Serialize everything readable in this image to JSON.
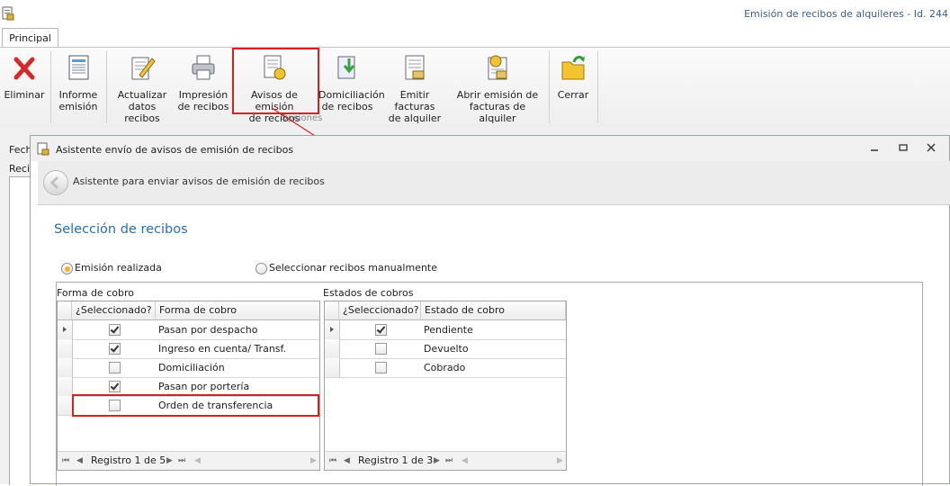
{
  "window": {
    "title": "Emisión de recibos de alquileres - Id. 244"
  },
  "tabs": [
    {
      "label": "Principal"
    }
  ],
  "ribbon": {
    "group_label": "Opciones",
    "buttons": [
      {
        "label": "Eliminar",
        "icon": "delete-x-icon"
      },
      {
        "label": "Informe\nemisión",
        "icon": "report-icon"
      },
      {
        "label": "Actualizar\ndatos recibos",
        "icon": "edit-document-icon"
      },
      {
        "label": "Impresión\nde recibos",
        "icon": "printer-icon"
      },
      {
        "label": "Avisos de emisión\nde recibos",
        "icon": "notice-icon"
      },
      {
        "label": "Domiciliación\nde recibos",
        "icon": "download-document-icon"
      },
      {
        "label": "Emitir facturas\nde alquiler",
        "icon": "invoice-icon"
      },
      {
        "label": "Abrir emisión de\nfacturas de alquiler",
        "icon": "open-invoice-icon"
      },
      {
        "label": "Cerrar",
        "icon": "close-folder-icon"
      }
    ]
  },
  "background": {
    "label1": "Fech",
    "label2": "Reci"
  },
  "dialog": {
    "title": "Asistente envío de avisos de emisión de recibos",
    "wizard_title": "Asistente para enviar avisos de emisión de recibos",
    "section_title": "Selección de recibos",
    "options": [
      {
        "label": "Emisión realizada",
        "selected": true
      },
      {
        "label": "Seleccionar recibos manualmente",
        "selected": false
      }
    ],
    "forma_cobro": {
      "label": "Forma de cobro",
      "columns": [
        "¿Seleccionado?",
        "Forma de cobro"
      ],
      "rows": [
        {
          "checked": true,
          "value": "Pasan por despacho"
        },
        {
          "checked": true,
          "value": "Ingreso en cuenta/ Transf."
        },
        {
          "checked": false,
          "value": "Domiciliación"
        },
        {
          "checked": true,
          "value": "Pasan por portería"
        },
        {
          "checked": false,
          "value": "Orden de transferencia"
        }
      ],
      "nav_text": "Registro 1 de 5"
    },
    "estados_cobro": {
      "label": "Estados de cobros",
      "columns": [
        "¿Seleccionado?",
        "Estado de cobro"
      ],
      "rows": [
        {
          "checked": true,
          "value": "Pendiente"
        },
        {
          "checked": false,
          "value": "Devuelto"
        },
        {
          "checked": false,
          "value": "Cobrado"
        }
      ],
      "nav_text": "Registro 1 de 3"
    }
  },
  "colors": {
    "highlight": "#d82020",
    "section_title": "#2a6fa8",
    "radio_on": "#f2b226"
  }
}
